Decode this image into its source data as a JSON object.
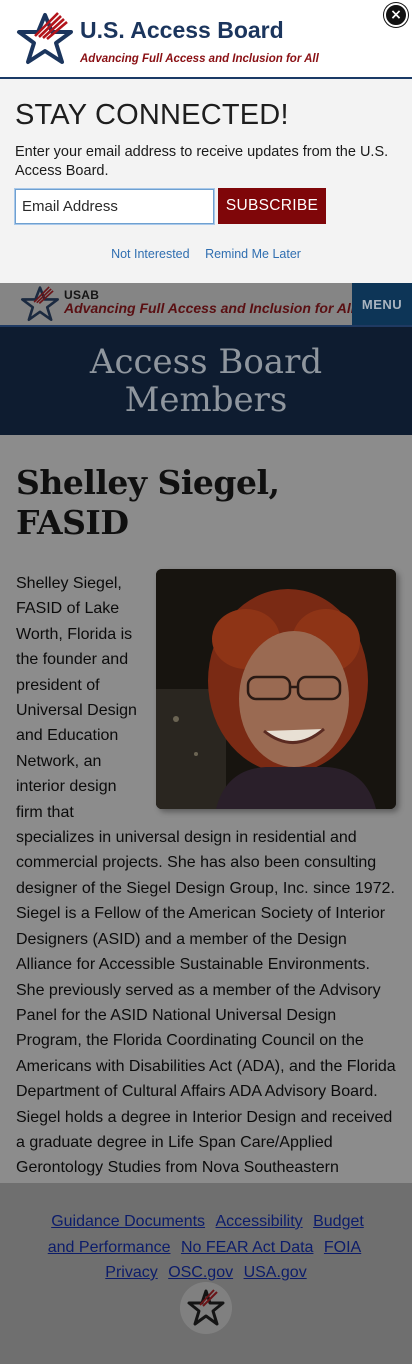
{
  "popup": {
    "brand_name": "U.S. Access Board",
    "brand_tagline": "Advancing Full Access and Inclusion for All",
    "close_symbol": "×",
    "heading": "STAY CONNECTED!",
    "description": "Enter your email address to receive updates from the U.S. Access Board.",
    "email_placeholder": "Email Address",
    "subscribe_label": "SUBSCRIBE",
    "not_interested": "Not Interested",
    "remind_later": "Remind Me Later"
  },
  "header": {
    "abbr": "USAB",
    "tagline": "Advancing Full Access and Inclusion for All",
    "menu_label": "MENU"
  },
  "banner": {
    "title": "Access Board Members"
  },
  "member": {
    "name": "Shelley Siegel, FASID",
    "bio": "Shelley Siegel, FASID of Lake Worth, Florida is the founder and president of Universal Design and Education Network, an interior design firm that specializes in universal design in residential and commercial projects. She has also been consulting designer of the Siegel Design Group, Inc. since 1972. Siegel is a Fellow of the American Society of Interior Designers (ASID) and a member of the Design Alliance for Accessible Sustainable Environments. She previously served as a member of the Advisory Panel for the ASID National Universal Design Program, the Florida Coordinating Council on the Americans with Disabilities Act (ADA), and the Florida Department of Cultural Affairs ADA Advisory Board. Siegel holds a degree in Interior Design and received a graduate degree in Life Span Care/Applied Gerontology Studies from Nova Southeastern University."
  },
  "footer": {
    "links": [
      "Guidance Documents",
      "Accessibility",
      "Budget and Performance",
      "No FEAR Act Data",
      "FOIA",
      "Privacy",
      "OSC.gov",
      "USA.gov"
    ]
  },
  "colors": {
    "navy": "#1b355d",
    "brand_red": "#7f0609",
    "link_blue": "#2f6eb0"
  },
  "icons": [
    "usab-star-logo",
    "close-icon"
  ]
}
